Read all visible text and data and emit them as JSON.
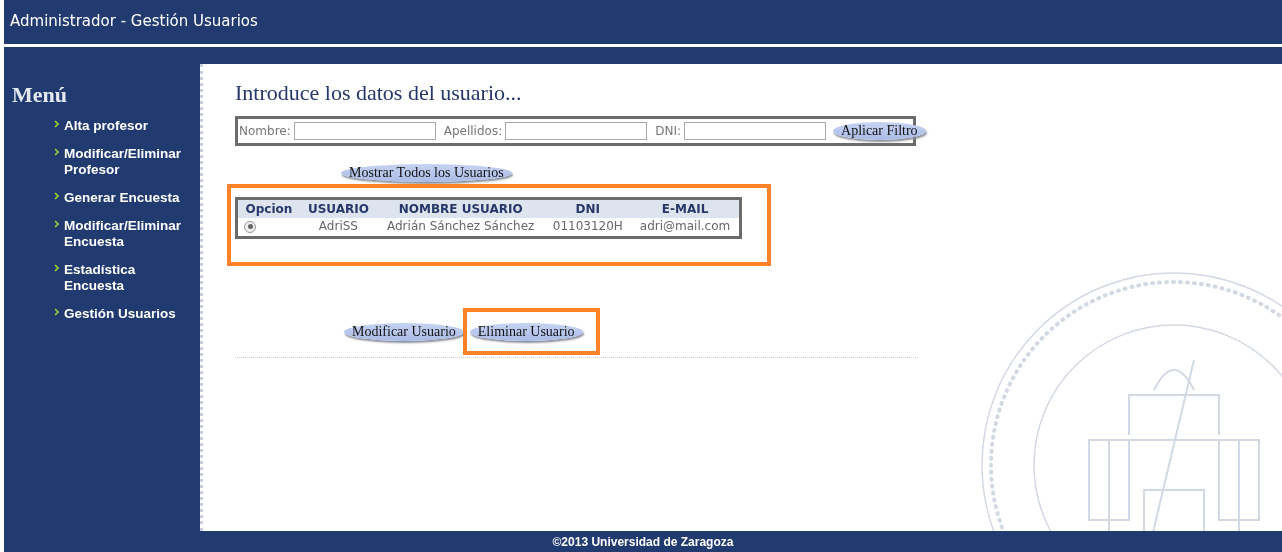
{
  "header": {
    "title": "Administrador - Gestión Usuarios"
  },
  "sidebar": {
    "title": "Menú",
    "items": [
      {
        "label": "Alta profesor"
      },
      {
        "label": "Modificar/Eliminar Profesor"
      },
      {
        "label": "Generar Encuesta"
      },
      {
        "label": "Modificar/Eliminar Encuesta"
      },
      {
        "label": "Estadística Encuesta"
      },
      {
        "label": "Gestión Usuarios"
      }
    ]
  },
  "content": {
    "heading": "Introduce los datos del usuario...",
    "filter": {
      "fields": [
        {
          "label": "Nombre:"
        },
        {
          "label": "Apellidos:"
        },
        {
          "label": "DNI:"
        }
      ],
      "button": "Aplicar Filtro"
    },
    "show_all_button": "Mostrar Todos los Usuarios",
    "table": {
      "columns": [
        "Opcion",
        "USUARIO",
        "NOMBRE USUARIO",
        "DNI",
        "E-MAIL"
      ],
      "rows": [
        {
          "selected": true,
          "cells": [
            "",
            "AdriSS",
            "Adrián Sánchez Sánchez",
            "01103120H",
            "adri@mail.com"
          ]
        }
      ]
    },
    "actions": [
      {
        "label": "Modificar Usuario",
        "highlighted": false
      },
      {
        "label": "Eliminar Usuario",
        "highlighted": true
      }
    ]
  },
  "footer": {
    "text": "©2013 Universidad de Zaragoza"
  }
}
